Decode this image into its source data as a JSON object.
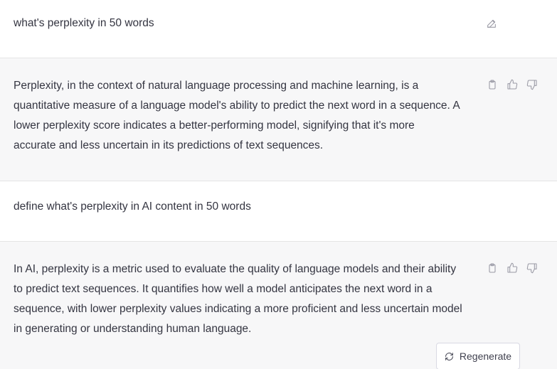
{
  "messages": [
    {
      "role": "user",
      "text": "what's perplexity in 50 words"
    },
    {
      "role": "assistant",
      "lines": [
        "Perplexity, in the context of natural language processing and machine learning, is a",
        "quantitative measure of a language model's ability to predict the next word in a sequence. A",
        "lower perplexity score indicates a better-performing model, signifying that it's more",
        "accurate and less uncertain in its predictions of text sequences."
      ]
    },
    {
      "role": "user",
      "text": "define what's perplexity in AI content in 50 words"
    },
    {
      "role": "assistant",
      "lines": [
        "In AI, perplexity is a metric used to evaluate the quality of language models and their ability",
        "to predict text sequences. It quantifies how well a model anticipates the next word in a",
        "sequence, with lower perplexity values indicating a more proficient and less uncertain model",
        "in generating or understanding human language."
      ]
    }
  ],
  "regenerate_label": "Regenerate",
  "icons": {
    "edit": "edit-icon",
    "copy": "clipboard-icon",
    "thumbs_up": "thumbs-up-icon",
    "thumbs_down": "thumbs-down-icon",
    "regenerate": "refresh-icon"
  }
}
